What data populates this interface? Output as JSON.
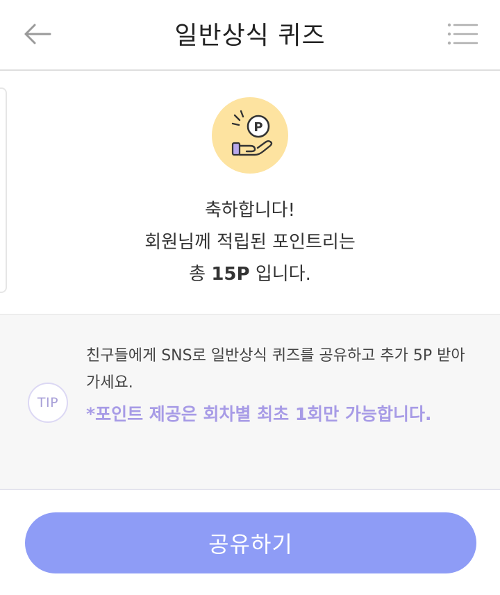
{
  "header": {
    "title": "일반상식 퀴즈",
    "back_icon": "arrow-left-icon",
    "menu_icon": "hamburger-menu-icon"
  },
  "result": {
    "icon": "hand-coin-point-icon",
    "coin_letter": "P",
    "line1": "축하합니다!",
    "line2": "회원님께 적립된 포인트리는",
    "line3_prefix": "총",
    "points": "15P",
    "line3_suffix": "입니다."
  },
  "tip": {
    "badge": "TIP",
    "description": "친구들에게 SNS로 일반상식 퀴즈를 공유하고 추가 5P 받아가세요.",
    "note": "*포인트 제공은 회차별 최초 1회만 가능합니다."
  },
  "share_button": {
    "label": "공유하기"
  },
  "colors": {
    "accent": "#8e9cf6",
    "note_purple": "#a79be6",
    "coin_bg": "#fde3a0",
    "tip_bg": "#f7f7f7"
  }
}
